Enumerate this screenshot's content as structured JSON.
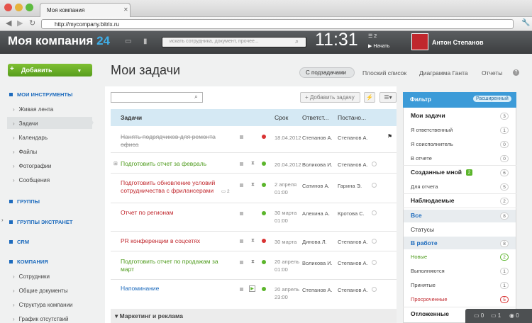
{
  "browser": {
    "tab_title": "Моя компания",
    "url": "http://mycompany.bitrix.ru"
  },
  "header": {
    "logo": "Моя компания",
    "logo_num": "24",
    "search_placeholder": "искать сотрудника, документ, прочее...",
    "clock": "11:31",
    "tasks_count": "2",
    "start_label": "Начать",
    "user_name": "Антон Степанов"
  },
  "toolbar": {
    "add_label": "Добавить",
    "page_title": "Мои задачи",
    "views": [
      "С подзадачами",
      "Плоский список",
      "Диаграмма Ганта",
      "Отчеты"
    ],
    "help": "?"
  },
  "sidebar": {
    "sections": [
      {
        "title": "МОИ ИНСТРУМЕНТЫ",
        "items": [
          "Живая лента",
          "Задачи",
          "Календарь",
          "Файлы",
          "Фотографии",
          "Сообщения"
        ]
      },
      {
        "title": "ГРУППЫ",
        "items": []
      },
      {
        "title": "ГРУППЫ ЭКСТРАНЕТ",
        "items": []
      },
      {
        "title": "CRM",
        "items": []
      },
      {
        "title": "КОМПАНИЯ",
        "items": [
          "Сотрудники",
          "Общие документы",
          "Структура компании",
          "График отсутствий"
        ]
      }
    ],
    "selected": "Задачи"
  },
  "tasks": {
    "add_task_label": "Добавить задачу",
    "columns": [
      "Задачи",
      "Срок",
      "Ответст...",
      "Постано..."
    ],
    "rows": [
      {
        "title": "Нанять подрядчиков для ремонта офиса",
        "deadline": "18.04.2012",
        "responsible": "Степанов А.",
        "director": "Степанов А.",
        "color": "#999999",
        "status": "#d93232"
      },
      {
        "title": "Подготовить отчет за февраль",
        "deadline": "20.04.2012",
        "responsible": "Воликова И.",
        "director": "Степанов А.",
        "color": "#4c9a1a",
        "status": "#5bb52b"
      },
      {
        "title": "Подготовить обновление условий сотрудничества с фрилансерами",
        "deadline": "2 апреля 01:00",
        "responsible": "Сатинов А.",
        "director": "Гарина Э.",
        "comments": "2",
        "color": "#c0272d",
        "status": "#5bb52b"
      },
      {
        "title": "Отчет по регионам",
        "deadline": "30 марта 01:00",
        "responsible": "Алехина А.",
        "director": "Кротова С.",
        "color": "#c0272d",
        "status": "#5bb52b"
      },
      {
        "title": "PR конференции в соцсетях",
        "deadline": "30 марта",
        "responsible": "Динова Л.",
        "director": "Степанов А.",
        "color": "#c0272d",
        "status": "#d93232"
      },
      {
        "title": "Подготовить отчет по продажам за март",
        "deadline": "20 апрель 01:00",
        "responsible": "Воликова И.",
        "director": "Степанов А.",
        "color": "#4c9a1a",
        "status": "#5bb52b"
      },
      {
        "title": "Напоминание",
        "deadline": "20 апрель 23:00",
        "responsible": "Степанов А.",
        "director": "Степанов А.",
        "color": "#1d6bbd",
        "status": "#5bb52b"
      }
    ],
    "section": "Маркетинг и реклама"
  },
  "filter": {
    "title": "Фильтр",
    "extended": "Расширенный",
    "items": [
      {
        "label": "Мои задачи",
        "count": "3",
        "bold": true
      },
      {
        "label": "Я ответственный",
        "count": "1"
      },
      {
        "label": "Я соисполнитель",
        "count": "0"
      },
      {
        "label": "В отчете",
        "count": "0"
      },
      {
        "label": "Созданные мной",
        "count": "6",
        "bold": true,
        "badge": "2"
      },
      {
        "label": "Для отчета",
        "count": "5"
      },
      {
        "label": "Наблюдаемые",
        "count": "2",
        "bold": true
      },
      {
        "label": "Все",
        "count": "8",
        "bold": true,
        "blue": true
      },
      {
        "label": "Статусы",
        "count": ""
      },
      {
        "label": "В работе",
        "count": "8",
        "bold": true,
        "blue": true
      },
      {
        "label": "Новые",
        "count": "2",
        "green": true
      },
      {
        "label": "Выполняются",
        "count": "1"
      },
      {
        "label": "Принятые",
        "count": "1"
      },
      {
        "label": "Просроченные",
        "count": "5",
        "red": true
      },
      {
        "label": "Отложенные",
        "count": "",
        "bold": true
      }
    ]
  },
  "bottom_bar": {
    "messages": "0",
    "notifications": "1",
    "users": "0"
  }
}
